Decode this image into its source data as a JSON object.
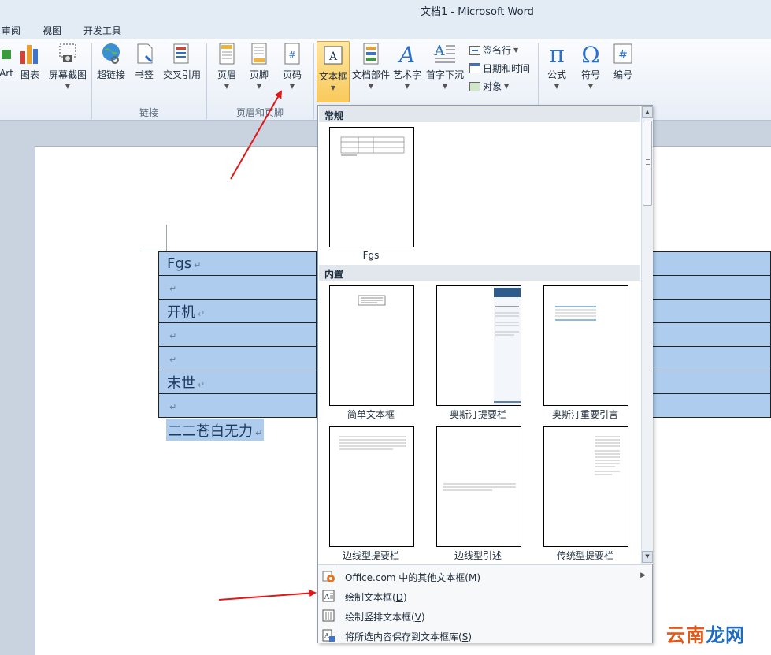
{
  "window": {
    "title": "文档1  -  Microsoft Word"
  },
  "tabs": [
    "审阅",
    "视图",
    "开发工具"
  ],
  "ribbon": {
    "buttons": {
      "smartart": "Art",
      "chart": "图表",
      "screenshot": "屏幕截图",
      "hyperlink": "超链接",
      "bookmark": "书签",
      "crossref": "交叉引用",
      "header": "页眉",
      "footer": "页脚",
      "pagenum": "页码",
      "textbox": "文本框",
      "quickparts": "文档部件",
      "wordart": "艺术字",
      "dropcap": "首字下沉",
      "equation": "公式",
      "symbol": "符号",
      "number": "编号"
    },
    "small": {
      "signature": "签名行",
      "datetime": "日期和时间",
      "object": "对象"
    },
    "groups": {
      "links": "链接",
      "headerfooter": "页眉和页脚"
    }
  },
  "document": {
    "rows": [
      "Fgs",
      "",
      "开机",
      "",
      "",
      "末世",
      ""
    ],
    "after_table": "二二苍白无力",
    "para_mark": "↵"
  },
  "dropdown": {
    "section_general": "常规",
    "section_builtin": "内置",
    "general_items": [
      {
        "label": "Fgs"
      }
    ],
    "builtin_items": [
      {
        "label": "简单文本框"
      },
      {
        "label": "奥斯汀提要栏"
      },
      {
        "label": "奥斯汀重要引言"
      },
      {
        "label": "边线型提要栏"
      },
      {
        "label": "边线型引述"
      },
      {
        "label": "传统型提要栏"
      }
    ],
    "menu": [
      {
        "pre": "Office.com 中的其他文本框(",
        "key": "M",
        "post": ")"
      },
      {
        "pre": "绘制文本框(",
        "key": "D",
        "post": ")"
      },
      {
        "pre": "绘制竖排文本框(",
        "key": "V",
        "post": ")"
      },
      {
        "pre": "将所选内容保存到文本框库(",
        "key": "S",
        "post": ")"
      }
    ]
  },
  "watermark": {
    "part1": "云南",
    "part2": "龙网"
  },
  "colors": {
    "selection": "#aecdee",
    "ribbon_active": "#f9c95b",
    "arrow": "#e01818",
    "watermark_red": "#e05a1c",
    "watermark_blue": "#1e6bbf"
  }
}
